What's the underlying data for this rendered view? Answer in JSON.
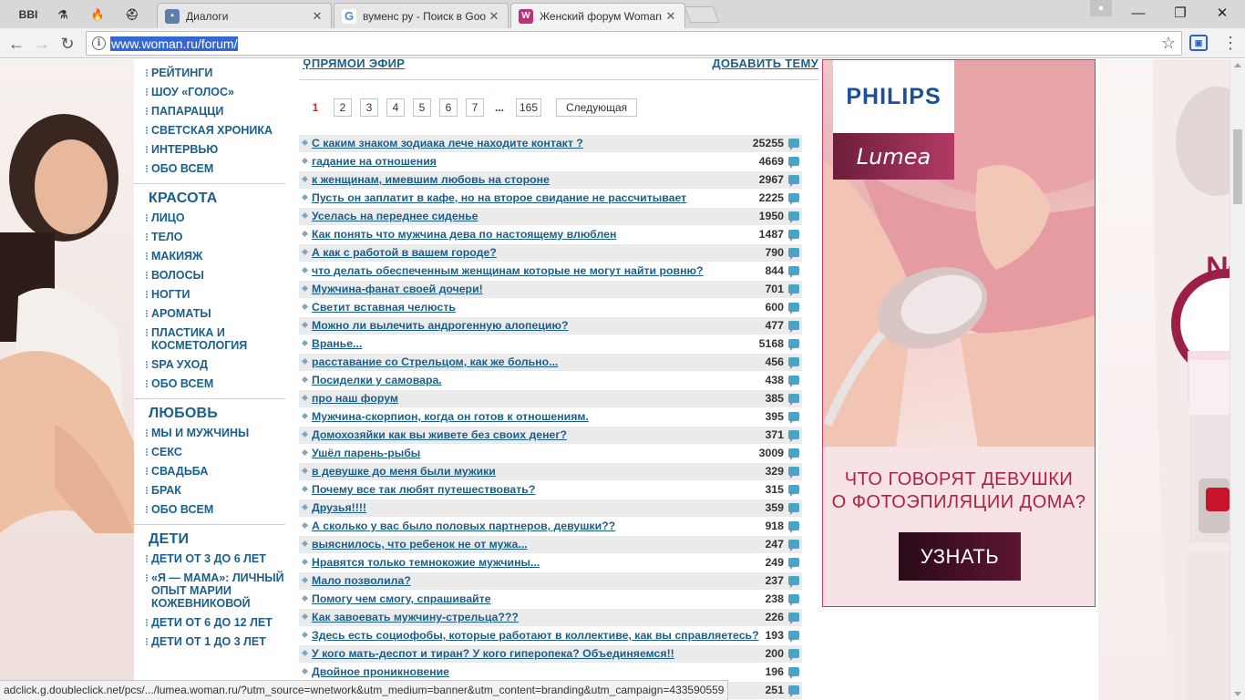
{
  "browser": {
    "pinned_tabs": [
      {
        "name": "bbi-pinned-tab",
        "glyph": "BBI"
      },
      {
        "name": "flask-pinned-tab",
        "glyph": "⚗"
      },
      {
        "name": "fire-pinned-tab",
        "glyph": "🔥"
      },
      {
        "name": "hat-pinned-tab",
        "glyph": "⛑"
      }
    ],
    "tabs": [
      {
        "title": "Диалоги",
        "icon_color": "#5b7fa6",
        "icon": "chat-icon"
      },
      {
        "title": "вуменс ру - Поиск в Goo",
        "icon_color": "#ffffff",
        "icon": "google-icon"
      },
      {
        "title": "Женский форум Woman",
        "icon_color": "#b8327c",
        "icon": "woman-icon",
        "active": true
      }
    ],
    "url": "www.woman.ru/forum/",
    "window_controls": {
      "minimize": "—",
      "restore": "❐",
      "close": "✕"
    }
  },
  "sidebar": {
    "top_items": [
      "РЕЙТИНГИ",
      "ШОУ «ГОЛОС»",
      "ПАПАРАЦЦИ",
      "СВЕТСКАЯ ХРОНИКА",
      "ИНТЕРВЬЮ",
      "ОБО ВСЕМ"
    ],
    "sections": [
      {
        "heading": "КРАСОТА",
        "items": [
          "ЛИЦО",
          "ТЕЛО",
          "МАКИЯЖ",
          "ВОЛОСЫ",
          "НОГТИ",
          "АРОМАТЫ",
          "ПЛАСТИКА И КОСМЕТОЛОГИЯ",
          "SPA УХОД",
          "ОБО ВСЕМ"
        ]
      },
      {
        "heading": "ЛЮБОВЬ",
        "items": [
          "МЫ И МУЖЧИНЫ",
          "СЕКС",
          "СВАДЬБА",
          "БРАК",
          "ОБО ВСЕМ"
        ]
      },
      {
        "heading": "ДЕТИ",
        "items": [
          "ДЕТИ ОТ 3 ДО 6 ЛЕТ",
          "«Я — МАМА»: ЛИЧНЫЙ ОПЫТ МАРИИ КОЖЕВНИКОВОЙ",
          "ДЕТИ ОТ 6 ДО 12 ЛЕТ",
          "ДЕТИ ОТ 1 ДО 3 ЛЕТ"
        ]
      }
    ]
  },
  "forum": {
    "live_link": "ПРЯМОЙ ЭФИР",
    "add_topic_link": "ДОБАВИТЬ ТЕМУ",
    "pagination": {
      "current": "1",
      "pages": [
        "2",
        "3",
        "4",
        "5",
        "6",
        "7"
      ],
      "ellipsis": "...",
      "last": "165",
      "next": "Следующая"
    },
    "topics": [
      {
        "title": "С каким знаком зодиака лече находите контакт ?",
        "count": "25255"
      },
      {
        "title": "гадание на отношения",
        "count": "4669"
      },
      {
        "title": "к женщинам, имевшим любовь на стороне",
        "count": "2967"
      },
      {
        "title": "Пусть он заплатит в кафе, но на второе свидание не рассчитывает",
        "count": "2225"
      },
      {
        "title": "Уселась на переднее сиденье",
        "count": "1950"
      },
      {
        "title": "Как понять что мужчина дева по настоящему влюблен",
        "count": "1487"
      },
      {
        "title": "А как с работой в вашем городе?",
        "count": "790"
      },
      {
        "title": "что делать обеспеченным женщинам которые не могут найти ровню?",
        "count": "844"
      },
      {
        "title": "Мужчина-фанат своей дочери!",
        "count": "701"
      },
      {
        "title": "Светит вставная челюсть",
        "count": "600"
      },
      {
        "title": "Можно ли вылечить андрогенную алопецию?",
        "count": "477"
      },
      {
        "title": "Вранье...",
        "count": "5168"
      },
      {
        "title": "расставание со Стрельцом, как же больно...",
        "count": "456"
      },
      {
        "title": "Посиделки у самовара.",
        "count": "438"
      },
      {
        "title": "про наш форум",
        "count": "385"
      },
      {
        "title": "Мужчина-скорпион, когда он готов к отношениям.",
        "count": "395"
      },
      {
        "title": "Домохозяйки как вы живете без своих денег?",
        "count": "371"
      },
      {
        "title": "Ушёл парень-рыбы",
        "count": "3009"
      },
      {
        "title": "в девушке до меня были мужики",
        "count": "329"
      },
      {
        "title": "Почему все так любят путешествовать?",
        "count": "315"
      },
      {
        "title": "Друзья!!!!",
        "count": "359"
      },
      {
        "title": "А сколько у вас было половых партнеров, девушки??",
        "count": "918"
      },
      {
        "title": "выяснилось, что ребенок не от мужа...",
        "count": "247"
      },
      {
        "title": "Нравятся только темнокожие мужчины...",
        "count": "249"
      },
      {
        "title": "Мало позволила?",
        "count": "237"
      },
      {
        "title": "Помогу чем смогу, спрашивайте",
        "count": "238"
      },
      {
        "title": "Как завоевать мужчину-стрельца???",
        "count": "226"
      },
      {
        "title": "Здесь есть социофобы, которые работают в коллективе, как вы справляетесь?",
        "count": "193"
      },
      {
        "title": "У кого мать-деспот и тиран? У кого гиперопека? Объединяемся!!",
        "count": "200"
      },
      {
        "title": "Двойное проникновение",
        "count": "196"
      },
      {
        "title": "",
        "count": "251"
      }
    ]
  },
  "ad": {
    "brand": "PHILIPS",
    "product": "Lumea",
    "headline_line1": "ЧТО ГОВОРЯТ ДЕВУШКИ",
    "headline_line2": "О ФОТОЭПИЛЯЦИИ ДОМА?",
    "button": "УЗНАТЬ"
  },
  "status_url": "adclick.g.doubleclick.net/pcs/.../lumea.woman.ru/?utm_source=wnetwork&utm_medium=banner&utm_content=branding&utm_campaign=433590559"
}
